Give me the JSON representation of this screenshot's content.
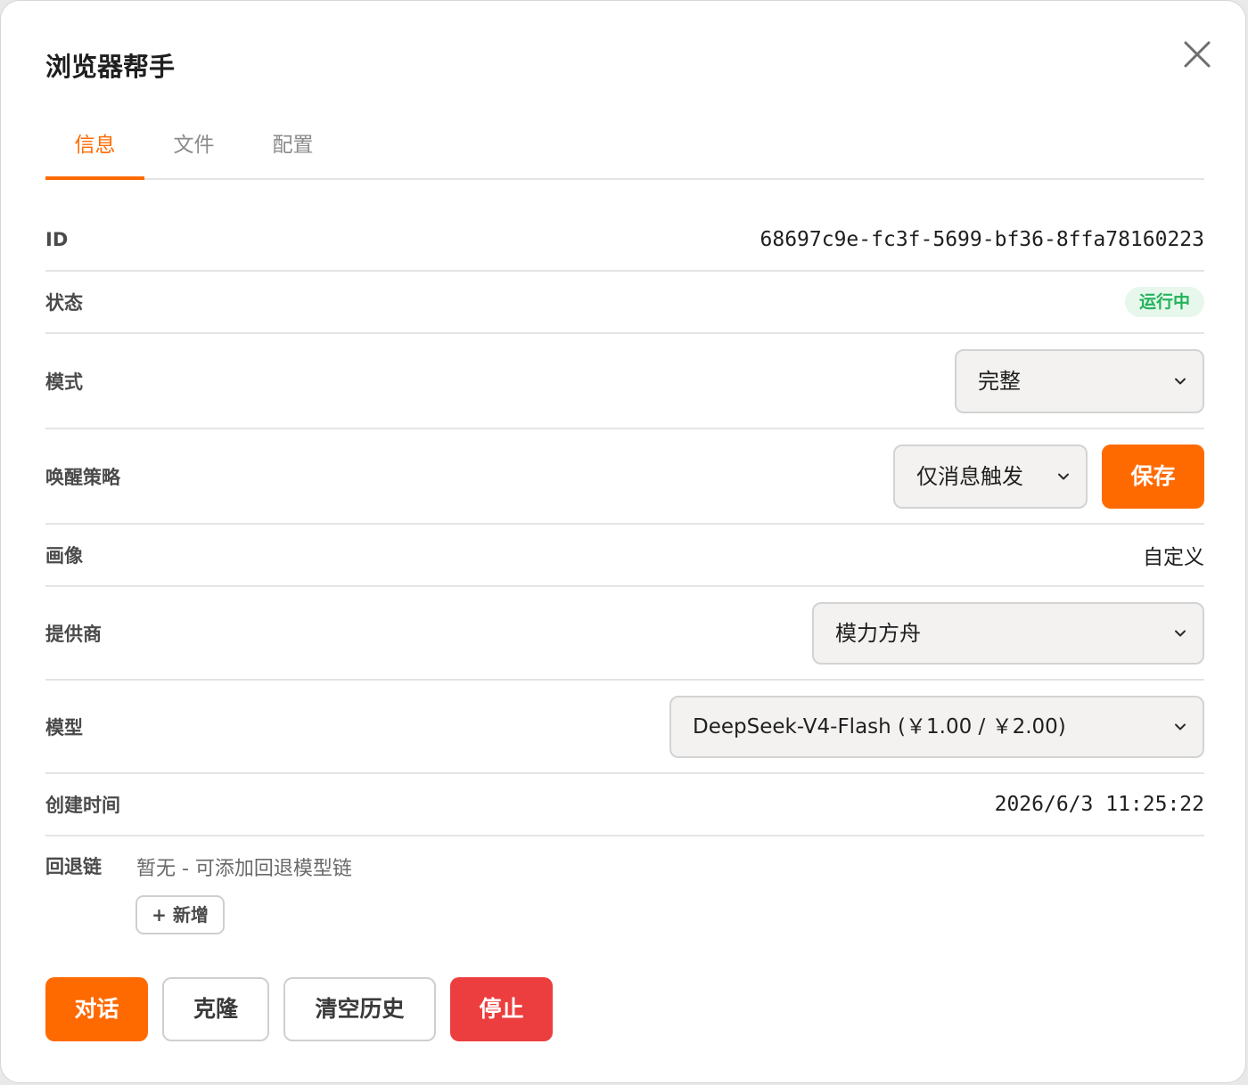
{
  "dialog": {
    "title": "浏览器帮手"
  },
  "icons": {
    "close": "close-icon",
    "chevron": "chevron-down-icon"
  },
  "tabs": [
    {
      "label": "信息",
      "active": true
    },
    {
      "label": "文件",
      "active": false
    },
    {
      "label": "配置",
      "active": false
    }
  ],
  "fields": {
    "id": {
      "label": "ID",
      "value": "68697c9e-fc3f-5699-bf36-8ffa78160223"
    },
    "status": {
      "label": "状态",
      "value": "运行中"
    },
    "mode": {
      "label": "模式",
      "value": "完整"
    },
    "wake": {
      "label": "唤醒策略",
      "value": "仅消息触发",
      "save_label": "保存"
    },
    "persona": {
      "label": "画像",
      "value": "自定义"
    },
    "provider": {
      "label": "提供商",
      "value": "模力方舟"
    },
    "model": {
      "label": "模型",
      "value": "DeepSeek-V4-Flash (￥1.00 / ￥2.00)"
    },
    "created": {
      "label": "创建时间",
      "value": "2026/6/3 11:25:22"
    },
    "fallback": {
      "label": "回退链",
      "empty_text": "暂无 - 可添加回退模型链",
      "add_label": "+ 新增"
    }
  },
  "actions": {
    "chat": "对话",
    "clone": "克隆",
    "clear_history": "清空历史",
    "stop": "停止"
  },
  "colors": {
    "accent": "#ff6a00",
    "danger": "#ec3e3e",
    "success": "#22b35a",
    "success_bg": "#e7f7ec"
  }
}
